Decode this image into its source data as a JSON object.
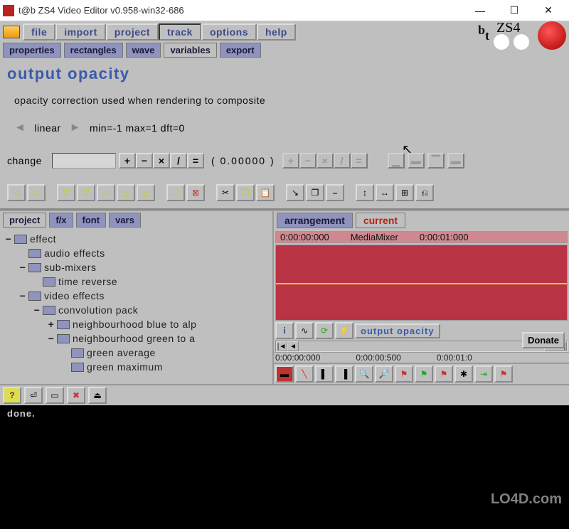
{
  "window": {
    "title": "t@b ZS4 Video Editor v0.958-win32-686"
  },
  "menubar": [
    "file",
    "import",
    "project",
    "track",
    "options",
    "help"
  ],
  "menubar_active": "track",
  "brand": {
    "t1": "t",
    "t2": "b",
    "zs": "ZS4"
  },
  "tabs": [
    "properties",
    "rectangles",
    "wave",
    "variables",
    "export"
  ],
  "tabs_active": "variables",
  "panel": {
    "title": "output opacity",
    "desc": "opacity correction used when rendering to composite",
    "mode": "linear",
    "range": "min=-1  max=1  dft=0",
    "change_label": "change",
    "value": "( 0.00000  )",
    "ops": [
      "+",
      "−",
      "×",
      "/",
      "="
    ],
    "ops2": [
      "+",
      "−",
      "×",
      "/",
      "="
    ]
  },
  "lower_tabs": [
    "project",
    "f/x",
    "font",
    "vars"
  ],
  "lower_tabs_active": "project",
  "tree": [
    {
      "l": 0,
      "t": "−",
      "f": true,
      "label": "effect"
    },
    {
      "l": 1,
      "t": "",
      "f": true,
      "label": "audio effects"
    },
    {
      "l": 1,
      "t": "−",
      "f": true,
      "label": "sub-mixers"
    },
    {
      "l": 2,
      "t": "",
      "f": true,
      "label": "time reverse"
    },
    {
      "l": 1,
      "t": "−",
      "f": true,
      "label": "video effects"
    },
    {
      "l": 2,
      "t": "−",
      "f": true,
      "label": "convolution pack"
    },
    {
      "l": 3,
      "t": "+",
      "f": true,
      "label": "neighbourhood blue to alp"
    },
    {
      "l": 3,
      "t": "−",
      "f": true,
      "label": "neighbourhood green to a"
    },
    {
      "l": 4,
      "t": "",
      "f": true,
      "label": "green average"
    },
    {
      "l": 4,
      "t": "",
      "f": true,
      "label": "green maximum"
    }
  ],
  "arrangement": {
    "tabs": [
      "arrangement",
      "current"
    ],
    "active": "current",
    "head_left": "0:00:00:000",
    "head_mid": "MediaMixer",
    "head_right": "0:00:01:000",
    "label": "output opacity",
    "scale": [
      "0:00:00:000",
      "0:00:00:500",
      "0:00:01:0"
    ]
  },
  "status": "done.",
  "donate": "Donate",
  "watermark": "LO4D.com"
}
